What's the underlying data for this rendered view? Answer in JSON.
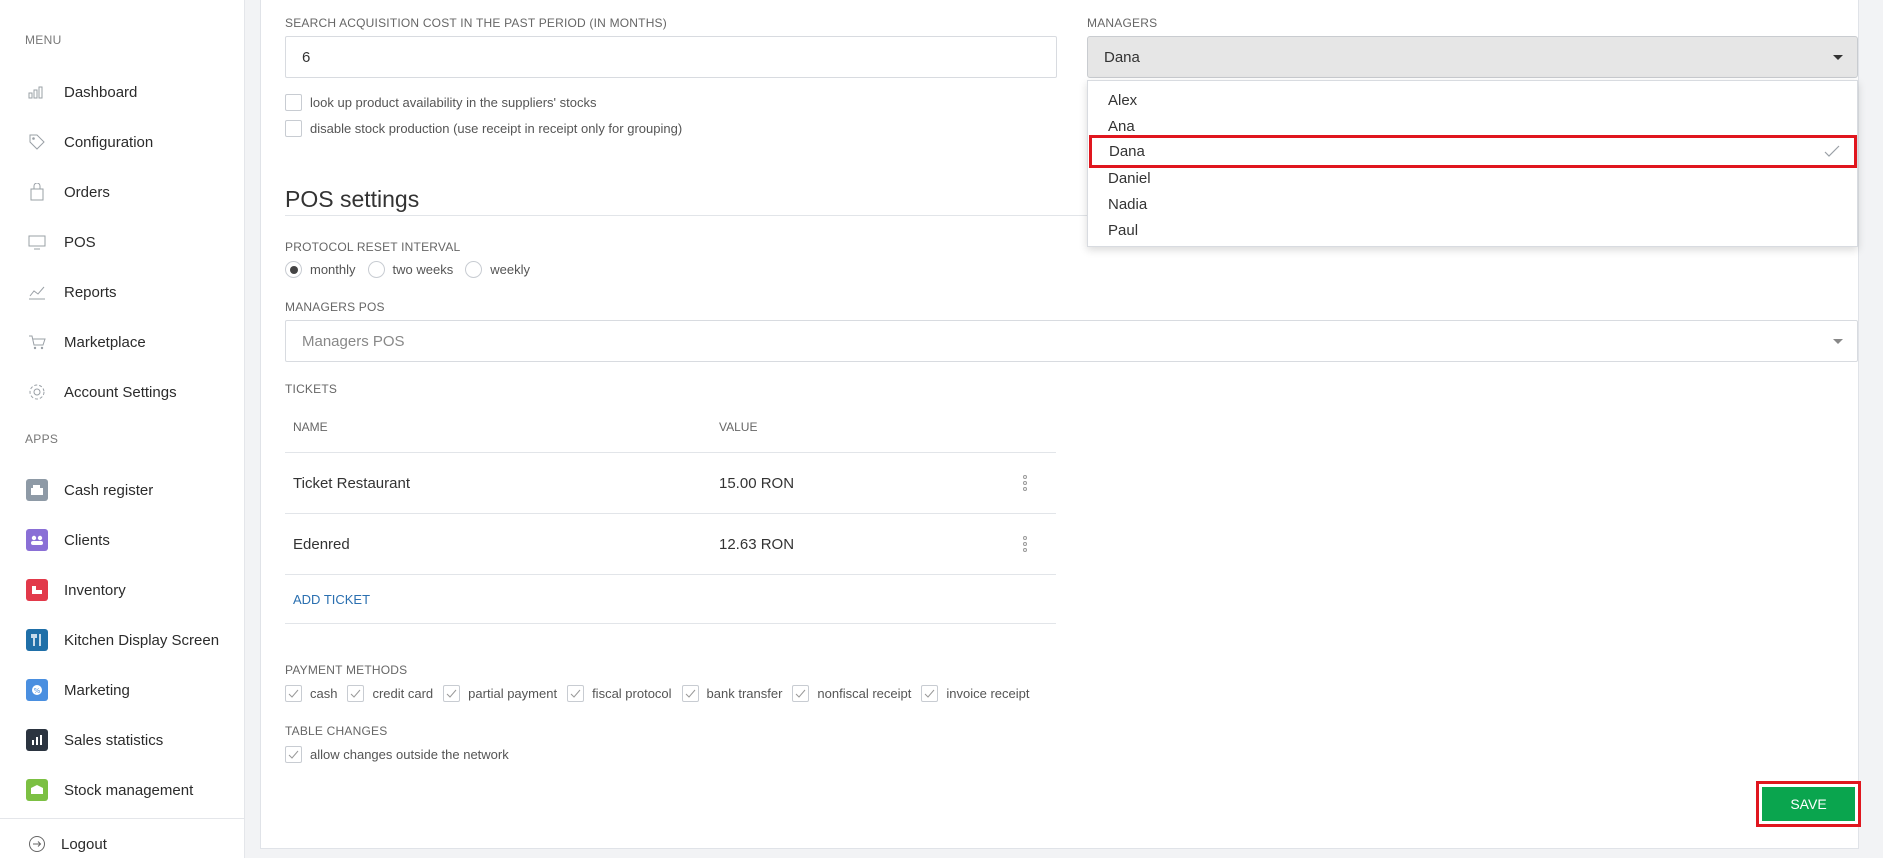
{
  "sidebar": {
    "menu_title": "MENU",
    "apps_title": "APPS",
    "menu_items": [
      {
        "label": "Dashboard",
        "icon": "chart-icon"
      },
      {
        "label": "Configuration",
        "icon": "tag-icon"
      },
      {
        "label": "Orders",
        "icon": "bag-icon"
      },
      {
        "label": "POS",
        "icon": "monitor-icon"
      },
      {
        "label": "Reports",
        "icon": "report-icon"
      },
      {
        "label": "Marketplace",
        "icon": "cart-icon"
      },
      {
        "label": "Account Settings",
        "icon": "gear-icon"
      }
    ],
    "app_items": [
      {
        "label": "Cash register",
        "icon": "cash-register-icon",
        "color": "#8e9aa6"
      },
      {
        "label": "Clients",
        "icon": "clients-icon",
        "color": "#8a6fd6"
      },
      {
        "label": "Inventory",
        "icon": "inventory-icon",
        "color": "#e2394a"
      },
      {
        "label": "Kitchen Display Screen",
        "icon": "kitchen-icon",
        "color": "#1f6fa8"
      },
      {
        "label": "Marketing",
        "icon": "marketing-icon",
        "color": "#4a8fe0"
      },
      {
        "label": "Sales statistics",
        "icon": "sales-icon",
        "color": "#2b3440"
      },
      {
        "label": "Stock management",
        "icon": "stock-icon",
        "color": "#7cc043"
      }
    ],
    "logout_label": "Logout"
  },
  "form": {
    "acquisition_label": "SEARCH ACQUISITION COST IN THE PAST PERIOD (IN MONTHS)",
    "acquisition_value": "6",
    "lookup_label": "look up product availability in the suppliers' stocks",
    "disable_stock_label": "disable stock production (use receipt in receipt only for grouping)",
    "managers_label": "MANAGERS",
    "managers_value": "Dana",
    "managers_options": [
      "Alex",
      "Ana",
      "Dana",
      "Daniel",
      "Nadia",
      "Paul"
    ],
    "managers_selected_index": 2
  },
  "pos": {
    "title": "POS settings",
    "protocol_label": "PROTOCOL RESET INTERVAL",
    "intervals": [
      "monthly",
      "two weeks",
      "weekly"
    ],
    "selected_interval": "monthly",
    "managers_pos_label": "MANAGERS POS",
    "managers_pos_placeholder": "Managers POS",
    "tickets_label": "TICKETS",
    "tickets_headers": {
      "name": "NAME",
      "value": "VALUE"
    },
    "tickets": [
      {
        "name": "Ticket Restaurant",
        "value": "15.00 RON"
      },
      {
        "name": "Edenred",
        "value": "12.63 RON"
      }
    ],
    "add_ticket_label": "ADD TICKET",
    "payment_label": "PAYMENT METHODS",
    "payment_methods": [
      "cash",
      "credit card",
      "partial payment",
      "fiscal protocol",
      "bank transfer",
      "nonfiscal receipt",
      "invoice receipt"
    ],
    "table_changes_label": "TABLE CHANGES",
    "table_changes_option": "allow changes outside the network"
  },
  "actions": {
    "save_label": "SAVE"
  },
  "colors": {
    "accent_green": "#0aa54e",
    "highlight_red": "#e0161e",
    "link_blue": "#2a6fb0"
  }
}
